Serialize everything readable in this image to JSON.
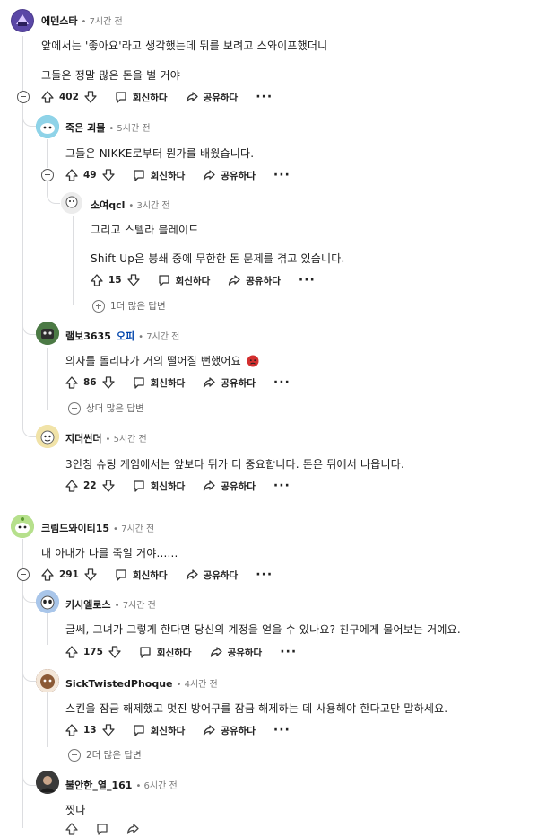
{
  "labels": {
    "reply": "회신하다",
    "share": "공유하다",
    "more": "···"
  },
  "comments": [
    {
      "id": "c1",
      "author": "에덴스타",
      "time": "7시간 전",
      "lines": [
        "앞에서는 '좋아요'라고 생각했는데 뒤를 보려고 스와이프했더니",
        "그들은 정말 많은 돈을 벌 거야"
      ],
      "votes": "402",
      "avatar_color": "#4b3a8c"
    },
    {
      "id": "c2",
      "author": "죽은 괴물",
      "time": "5시간 전",
      "lines": [
        "그들은 NIKKE로부터 뭔가를 배웠습니다."
      ],
      "votes": "49",
      "avatar_color": "#3bb8d6"
    },
    {
      "id": "c3",
      "author": "소여qcl",
      "time": "3시간 전",
      "lines": [
        "그리고 스텔라 블레이드",
        "Shift Up은 붕쇄 중에 무한한 돈 문제를 겪고 있습니다."
      ],
      "votes": "15",
      "more_replies": "1더 많은 답변",
      "avatar_color": "#c9c9c9"
    },
    {
      "id": "c4",
      "author": "램보3635",
      "op": "오피",
      "time": "7시간 전",
      "lines": [
        "의자를 돌리다가 거의 떨어질 뻔했어요"
      ],
      "votes": "86",
      "more_replies": "상더 많은 답변",
      "avatar_color": "#3d6b3a"
    },
    {
      "id": "c5",
      "author": "지더썬더",
      "time": "5시간 전",
      "lines": [
        "3인칭 슈팅 게임에서는 앞보다 뒤가 더 중요합니다. 돈은 뒤에서 나옵니다."
      ],
      "votes": "22",
      "avatar_color": "#e8d38a"
    },
    {
      "id": "c6",
      "author": "크림드와이티15",
      "time": "7시간 전",
      "lines": [
        "내 아내가 나를 죽일 거야......"
      ],
      "votes": "291",
      "avatar_color": "#9ad16b"
    },
    {
      "id": "c7",
      "author": "키시엘로스",
      "time": "7시간 전",
      "lines": [
        "글쎄, 그녀가 그렇게 한다면 당신의 계정을 얻을 수 있나요? 친구에게 물어보는 거예요."
      ],
      "votes": "175",
      "avatar_color": "#8fb3e0"
    },
    {
      "id": "c8",
      "author": "SickTwistedPhoque",
      "time": "4시간 전",
      "lines": [
        "스킨을 잠금 해제했고 멋진 방어구를 잠금 해제하는 데 사용해야 한다고만 말하세요."
      ],
      "votes": "13",
      "more_replies": "2더 많은 답변",
      "avatar_color": "#7a4a2e"
    },
    {
      "id": "c9",
      "author": "불안한_열_161",
      "time": "6시간 전",
      "lines": [
        "찟다"
      ],
      "avatar_color": "#2e2e2e"
    }
  ]
}
